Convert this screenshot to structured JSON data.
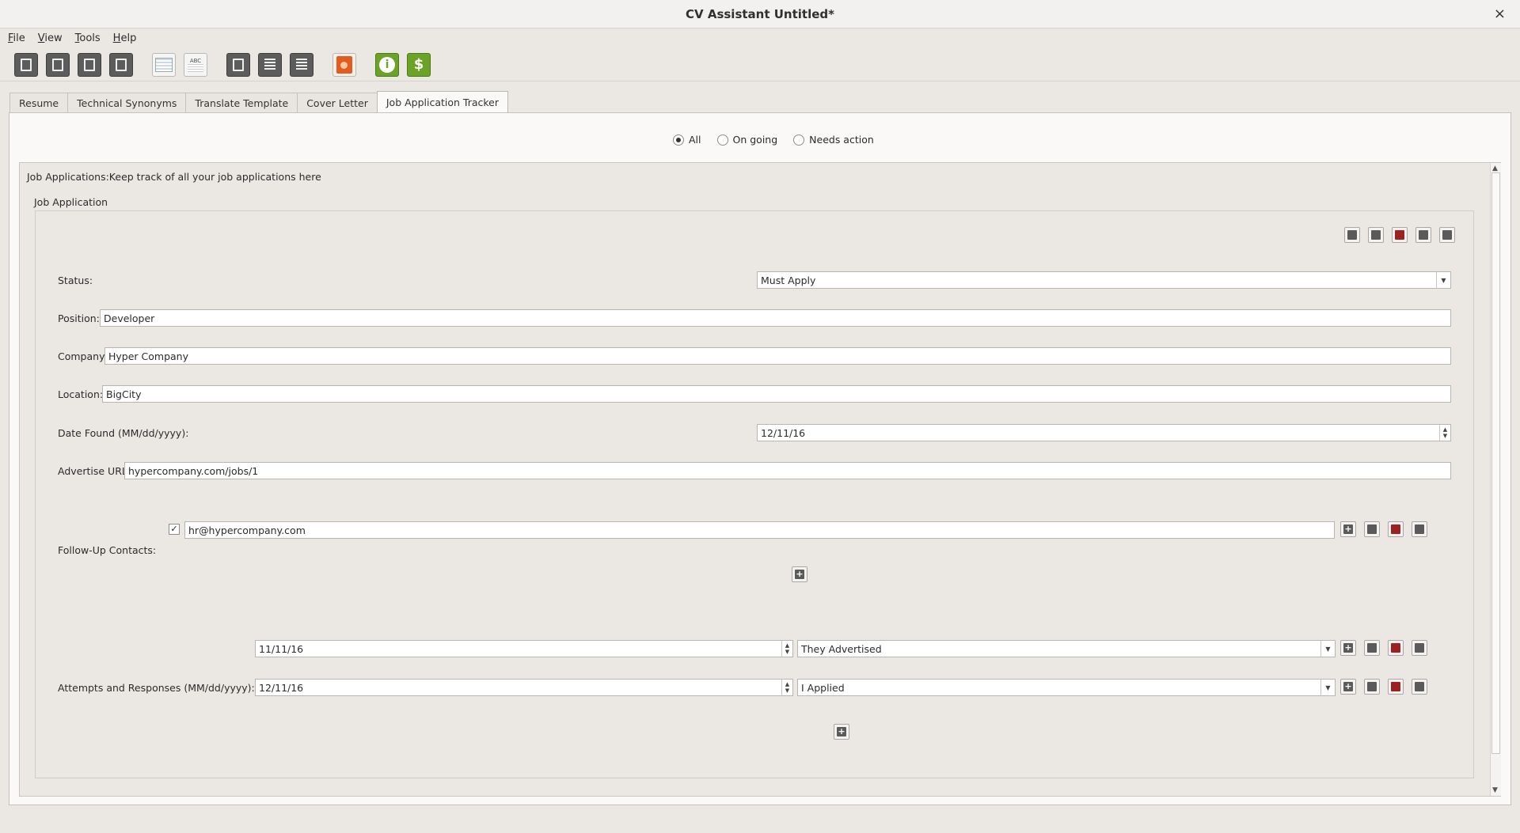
{
  "window": {
    "title": "CV Assistant Untitled*",
    "close_glyph": "×"
  },
  "menu": [
    "File",
    "View",
    "Tools",
    "Help"
  ],
  "toolbar": [
    {
      "icon": "new-document-icon",
      "style": "dark"
    },
    {
      "icon": "open-document-icon",
      "style": "dark"
    },
    {
      "icon": "save-document-icon",
      "style": "dark"
    },
    {
      "icon": "save-as-document-icon",
      "style": "dark"
    },
    {
      "icon": "resume-card-icon",
      "style": "light"
    },
    {
      "icon": "spellcheck-icon",
      "style": "light",
      "text": "ABC"
    },
    {
      "icon": "export-icon",
      "style": "dark"
    },
    {
      "icon": "list-icon",
      "style": "dark"
    },
    {
      "icon": "document-list-icon",
      "style": "dark"
    },
    {
      "icon": "presentation-icon",
      "style": "orange"
    },
    {
      "icon": "info-icon",
      "style": "green",
      "text": "i"
    },
    {
      "icon": "donate-icon",
      "style": "green",
      "text": "$"
    }
  ],
  "tabs": [
    {
      "label": "Resume",
      "active": false
    },
    {
      "label": "Technical Synonyms",
      "active": false
    },
    {
      "label": "Translate Template",
      "active": false
    },
    {
      "label": "Cover Letter",
      "active": false
    },
    {
      "label": "Job Application Tracker",
      "active": true
    }
  ],
  "filter": {
    "options": [
      "All",
      "On going",
      "Needs action"
    ],
    "selected": "All"
  },
  "section": {
    "header": "Job Applications:Keep track of all your job applications here",
    "group_title": "Job Application"
  },
  "form": {
    "status_label": "Status:",
    "status_value": "Must Apply",
    "position_label": "Position:",
    "position_value": "Developer",
    "company_label": "Company:",
    "company_value": "Hyper Company",
    "location_label": "Location:",
    "location_value": "BigCity",
    "date_found_label": "Date Found (MM/dd/yyyy):",
    "date_found_value": "12/11/16",
    "url_label": "Advertise URL:",
    "url_value": "hypercompany.com/jobs/1",
    "followup_label": "Follow-Up Contacts:",
    "followup_contacts": [
      {
        "checked": true,
        "value": "hr@hypercompany.com"
      }
    ],
    "attempts_label": "Attempts and Responses (MM/dd/yyyy):",
    "attempts": [
      {
        "date": "11/11/16",
        "type": "They Advertised"
      },
      {
        "date": "12/11/16",
        "type": "I Applied"
      }
    ]
  },
  "colors": {
    "accent_dark": "#5c5c5c",
    "delete_red": "#9e2121",
    "green_button": "#6aa325",
    "orange_icon": "#e35b1e"
  }
}
